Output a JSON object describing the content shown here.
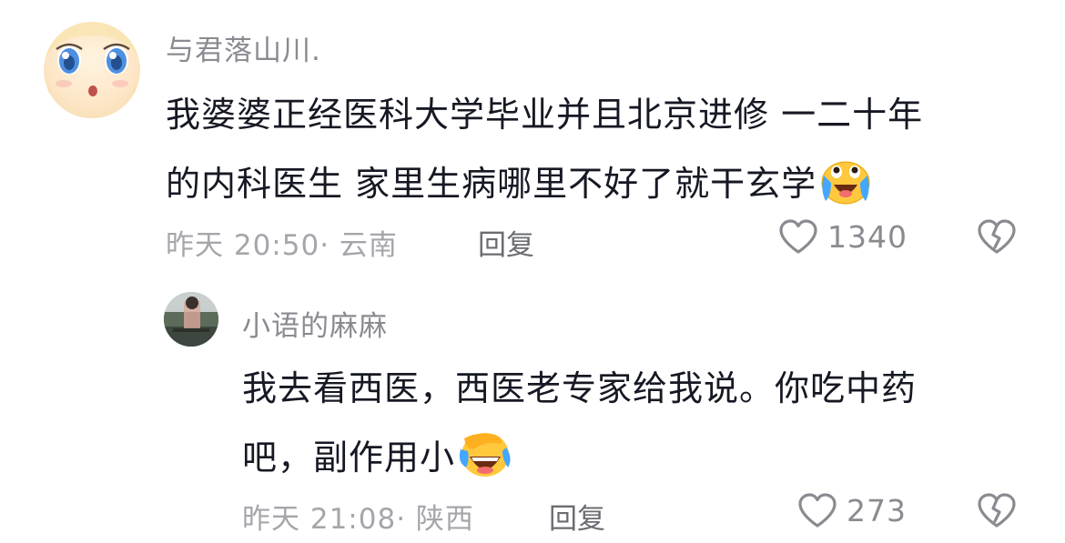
{
  "comments": [
    {
      "username": "与君落山川.",
      "content_lines": [
        "我婆婆正经医科大学毕业并且北京进修 一二十年",
        "的内科医生 家里生病哪里不好了就干玄学"
      ],
      "emoji": "loudly-crying-face",
      "time_location": "昨天 20:50· 云南",
      "reply_label": "回复",
      "likes": "1340",
      "icons": {
        "like": "heart-outline-icon",
        "dislike": "broken-heart-icon"
      }
    },
    {
      "username": "小语的麻麻",
      "content_lines": [
        "我去看西医，西医老专家给我说。你吃中药",
        "吧，副作用小"
      ],
      "emoji": "crying-laughing-face",
      "time_location": "昨天 21:08· 陕西",
      "reply_label": "回复",
      "likes": "273",
      "icons": {
        "like": "heart-outline-icon",
        "dislike": "broken-heart-icon"
      }
    }
  ],
  "colors": {
    "text_primary": "#161823",
    "text_secondary": "#8a8b91",
    "text_meta": "#a5a6ab",
    "emoji_yellow": "#ffc83d",
    "tear_blue": "#43a6ff"
  }
}
